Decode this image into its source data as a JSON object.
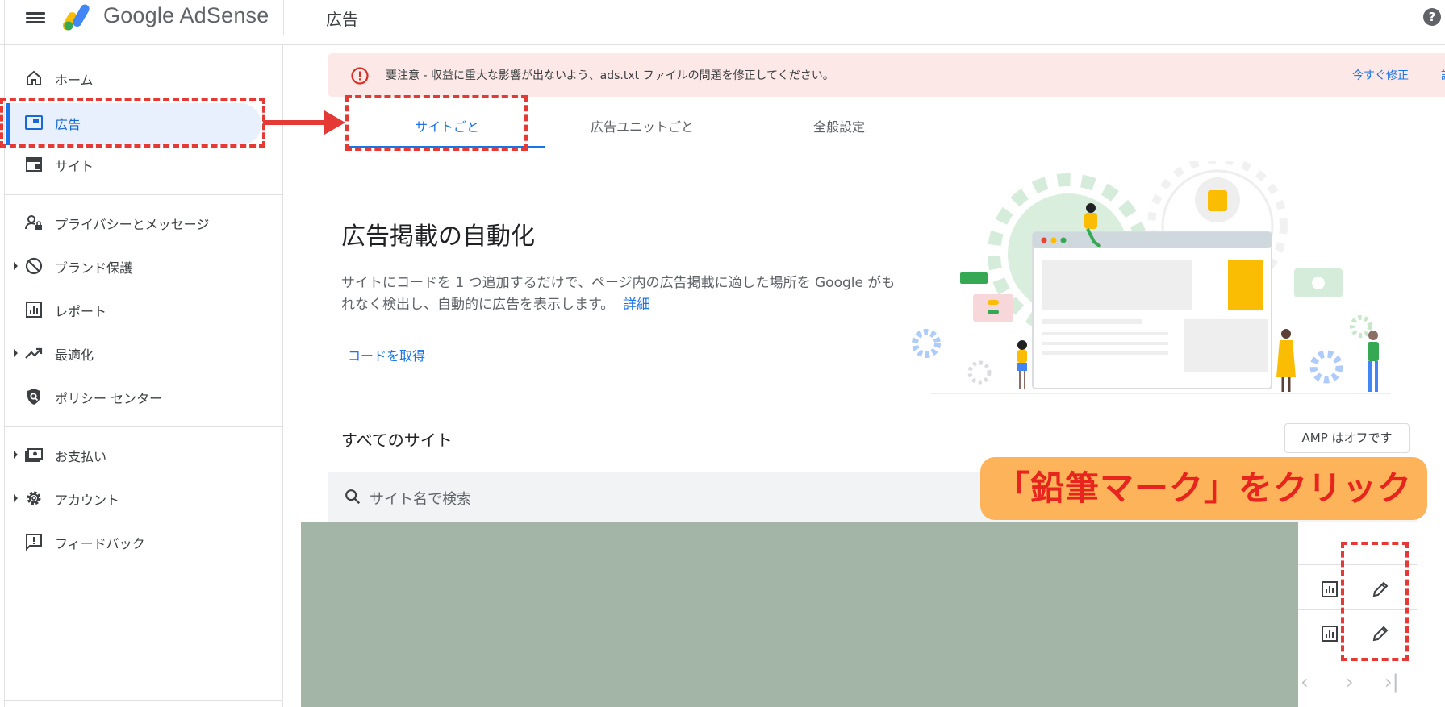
{
  "header": {
    "brand": "Google AdSense",
    "page_title": "広告",
    "help_glyph": "?"
  },
  "sidebar": {
    "items": [
      {
        "label": "ホーム",
        "icon": "home-icon"
      },
      {
        "label": "広告",
        "icon": "ads-icon",
        "active": true
      },
      {
        "label": "サイト",
        "icon": "sites-icon"
      },
      {
        "label": "プライバシーとメッセージ",
        "icon": "privacy-icon"
      },
      {
        "label": "ブランド保護",
        "icon": "block-icon",
        "expandable": true
      },
      {
        "label": "レポート",
        "icon": "report-icon"
      },
      {
        "label": "最適化",
        "icon": "trending-icon",
        "expandable": true
      },
      {
        "label": "ポリシー センター",
        "icon": "shield-icon"
      },
      {
        "label": "お支払い",
        "icon": "payments-icon",
        "expandable": true
      },
      {
        "label": "アカウント",
        "icon": "gear-icon",
        "expandable": true
      },
      {
        "label": "フィードバック",
        "icon": "feedback-icon"
      }
    ]
  },
  "alert": {
    "text": "要注意 - 収益に重大な影響が出ないよう、ads.txt ファイルの問題を修正してください。",
    "action": "今すぐ修正",
    "action_cut": "詳",
    "color": "#fce8e6"
  },
  "tabs": [
    {
      "label": "サイトごと",
      "selected": true
    },
    {
      "label": "広告ユニットごと"
    },
    {
      "label": "全般設定"
    }
  ],
  "hero": {
    "title": "広告掲載の自動化",
    "desc": "サイトにコードを 1 つ追加するだけで、ページ内の広告掲載に適した場所を Google がもれなく検出し、自動的に広告を表示します。",
    "more_link": "詳細",
    "get_code": "コードを取得"
  },
  "sites": {
    "title": "すべてのサイト",
    "amp_chip": "AMP はオフです",
    "search_placeholder": "サイト名で検索"
  },
  "pager": {
    "prev": "‹",
    "next": "›",
    "last": "›|"
  },
  "annotation": {
    "callout": "「鉛筆マーク」をクリック",
    "accent": "#e53935"
  },
  "colors": {
    "primary": "#1a73e8",
    "active_bg": "#e8f0fe",
    "redacted": "#a3b5a6",
    "callout_bg": "#fdb35a"
  }
}
